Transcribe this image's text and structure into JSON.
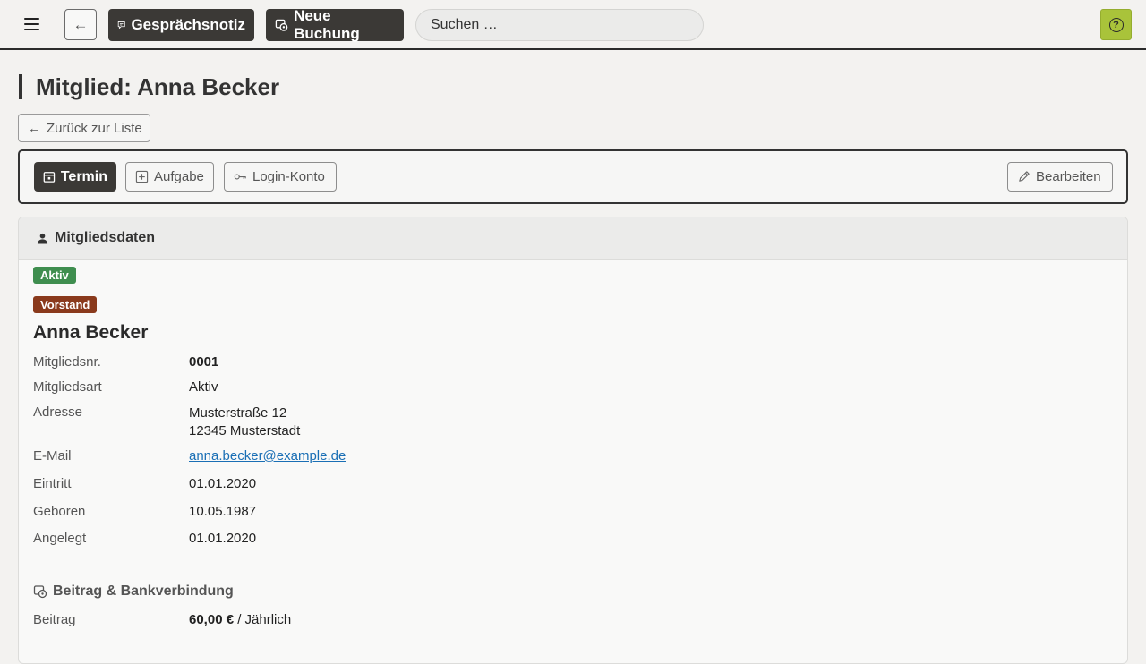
{
  "topbar": {
    "back_symbol": "←",
    "notiz_label": "Gesprächsnotiz",
    "buchung_label": "Neue Buchung",
    "search_placeholder": "Suchen …",
    "help_symbol": "?"
  },
  "page": {
    "title": "Mitglied: Anna Becker",
    "back_to_list": "Zurück zur Liste"
  },
  "actions": {
    "termin": "Termin",
    "aufgabe": "Aufgabe",
    "login": "Login-Konto",
    "edit": "Bearbeiten"
  },
  "card": {
    "header": "Mitgliedsdaten",
    "badges": {
      "status": "Aktiv",
      "role": "Vorstand"
    },
    "name": "Anna Becker",
    "fields": {
      "mitgliedsnr": {
        "label": "Mitgliedsnr.",
        "value": "0001"
      },
      "mitgliedsart": {
        "label": "Mitgliedsart",
        "value": "Aktiv"
      },
      "adresse": {
        "label": "Adresse",
        "line1": "Musterstraße 12",
        "line2": "12345 Musterstadt"
      },
      "email": {
        "label": "E-Mail",
        "value": "anna.becker@example.de"
      },
      "eintritt": {
        "label": "Eintritt",
        "value": "01.01.2020"
      },
      "geboren": {
        "label": "Geboren",
        "value": "10.05.1987"
      },
      "angelegt": {
        "label": "Angelegt",
        "value": "01.01.2020"
      }
    },
    "beitrag_section": {
      "title": "Beitrag & Bankverbindung",
      "beitrag_label": "Beitrag",
      "beitrag_amount": "60,00 €",
      "beitrag_interval": " / Jährlich"
    }
  },
  "colors": {
    "accent_dark": "#3b3936",
    "help_green": "#a9c33a",
    "badge_aktiv": "#3f8e4f",
    "badge_vorstand": "#8a3a1c",
    "link": "#1a6fb5"
  },
  "icons": {
    "menu": "hamburger-icon",
    "notiz": "comment-icon",
    "buchung": "coins-icon",
    "help": "question-circle-icon",
    "termin": "calendar-icon",
    "aufgabe": "plus-square-icon",
    "login": "key-icon",
    "edit": "pencil-icon",
    "header": "person-icon",
    "beitrag": "coins-icon"
  }
}
